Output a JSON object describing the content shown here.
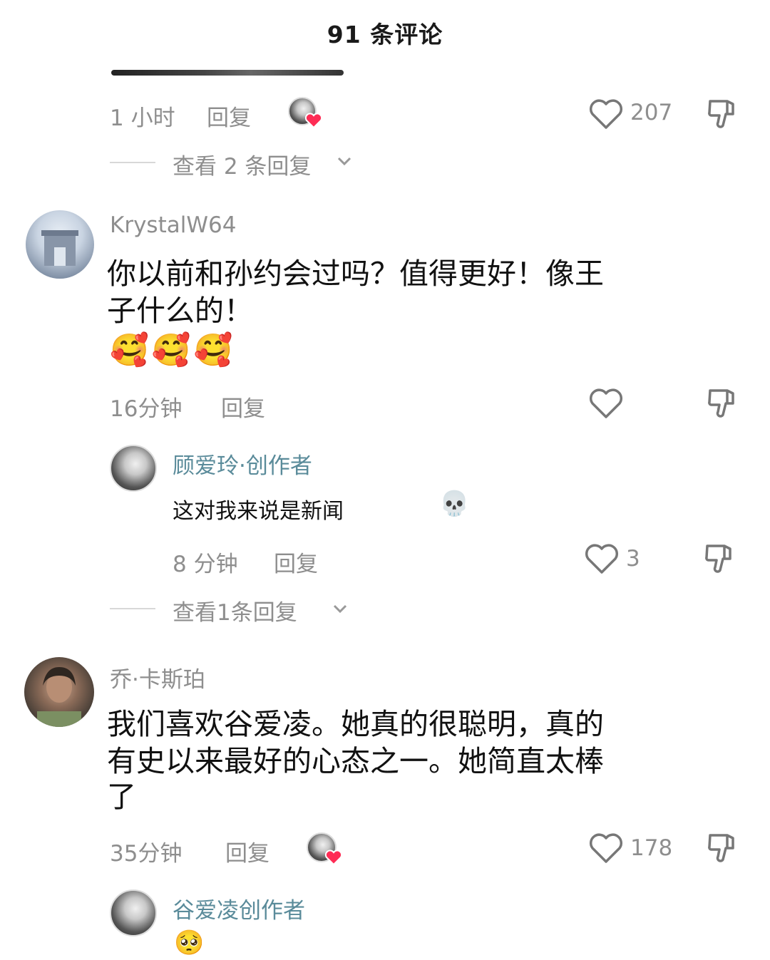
{
  "header": {
    "title": "91 条评论"
  },
  "comment_top": {
    "time": "1 小时",
    "reply_label": "回复",
    "likes": "207",
    "view_replies": "查看 2 条回复"
  },
  "comment_1": {
    "username": "KrystalW64",
    "text_line1": "你以前和孙约会过吗？值得更好！像王",
    "text_line2": "子什么的！",
    "emojis": "🥰🥰🥰",
    "time": "16分钟",
    "reply_label": "回复",
    "reply": {
      "username": "顾爱玲·创作者",
      "text": "这对我来说是新闻",
      "emoji": "💀",
      "time": "8 分钟",
      "reply_label": "回复",
      "likes": "3"
    },
    "view_replies": "查看1条回复"
  },
  "comment_2": {
    "username": "乔·卡斯珀",
    "text_line1": "我们喜欢谷爱凌。她真的很聪明，真的",
    "text_line2": "有史以来最好的心态之一。她简直太棒",
    "text_line3": "了",
    "time": "35分钟",
    "reply_label": "回复",
    "likes": "178",
    "reply": {
      "username": "谷爱凌创作者",
      "emoji": "🥺"
    }
  },
  "icons": {
    "like": "heart-outline-icon",
    "dislike": "thumbs-down-icon",
    "chevron": "chevron-down-icon",
    "creator_liked": "creator-liked-avatar-icon"
  },
  "colors": {
    "meta_gray": "#8e8e8e",
    "creator_teal": "#5a8b9a",
    "heart_red": "#fe2c55"
  }
}
